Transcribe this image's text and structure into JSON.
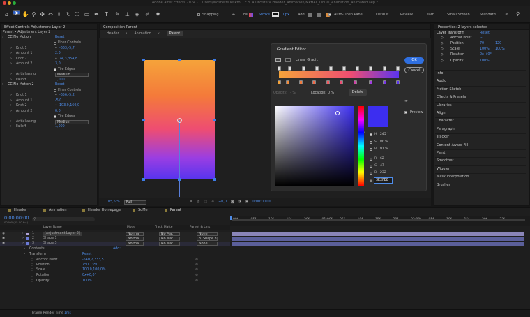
{
  "title": "Adobe After Effects 2024 - ...Users/inosbelt/Deskto... F > A Un5ste V Haeder_Animation/MPHAL_Doual_Animation_Animated.aep *",
  "toolbar": {
    "snapping": "Snapping",
    "fill": "Fill",
    "stroke": "Stroke",
    "stroke_px": "0 px",
    "add": "Add:",
    "auto_open": "Auto-Open Panel",
    "workspaces": [
      "Default",
      "Review",
      "Learn",
      "Small Screen",
      "Standard"
    ]
  },
  "effect_controls": {
    "tab": "Effect Controls Adjustment Layer 2",
    "layer": "Parent • Adjustment Layer 2",
    "rows": [
      {
        "label": "CC Flo Motion",
        "value": "Reset",
        "indent": 0
      },
      {
        "label": "Finer Controls",
        "value": "",
        "indent": 2,
        "check": false
      },
      {
        "label": "Knot 1",
        "value": "-663,-5,7",
        "indent": 1
      },
      {
        "label": "Amount 1",
        "value": "2,0",
        "indent": 1
      },
      {
        "label": "Knot 2",
        "value": "74,3,354,8",
        "indent": 1
      },
      {
        "label": "Amount 2",
        "value": "3,0",
        "indent": 1
      },
      {
        "label": "Tile Edges",
        "value": "",
        "indent": 2,
        "check": true
      },
      {
        "label": "Antialiasing",
        "value": "Medium",
        "indent": 1,
        "select": true
      },
      {
        "label": "Falloff",
        "value": "1,000",
        "indent": 1
      },
      {
        "label": "CC Flo Motion 2",
        "value": "Reset",
        "indent": 0
      },
      {
        "label": "Finer Controls",
        "value": "",
        "indent": 2,
        "check": false
      },
      {
        "label": "Knot 1",
        "value": "-656,-5,2",
        "indent": 1
      },
      {
        "label": "Amount 1",
        "value": "-5,0",
        "indent": 1
      },
      {
        "label": "Knot 2",
        "value": "103,0,160,0",
        "indent": 1
      },
      {
        "label": "Amount 2",
        "value": "0,0",
        "indent": 1
      },
      {
        "label": "Tile Edges",
        "value": "",
        "indent": 2,
        "check": true
      },
      {
        "label": "Antialiasing",
        "value": "Medium",
        "indent": 1,
        "select": true
      },
      {
        "label": "Falloff",
        "value": "1,000",
        "indent": 1
      }
    ]
  },
  "composition": {
    "tab": "Composition Parent",
    "crumbs": [
      "Header",
      "Animation",
      "Parent"
    ],
    "zoom": "105,6 %",
    "quality": "Full",
    "exposure": "+0,0",
    "timecode": "0:00:00:00"
  },
  "gradient_editor": {
    "title": "Gradient Editor",
    "type": "Linear Gradi...",
    "ok": "OK",
    "cancel": "Cancel",
    "opacity_label": "Opacity:",
    "opacity_value": "- %",
    "location_label": "Location:",
    "location_value": "0 %",
    "delete": "Delete",
    "preview": "Preview",
    "swatch_color": "#3c2ef0",
    "fields": [
      {
        "name": "H",
        "value": "245 °"
      },
      {
        "name": "S",
        "value": "80 %"
      },
      {
        "name": "B",
        "value": "91 %"
      },
      {
        "name": "R",
        "value": "62"
      },
      {
        "name": "G",
        "value": "47"
      },
      {
        "name": "B",
        "value": "232"
      }
    ],
    "hex": "3E2FE8"
  },
  "properties": {
    "header": "Properties: 2 layers selected",
    "group": "Layer Transform",
    "reset": "Reset",
    "rows": [
      {
        "label": "Anchor Point",
        "v1": "--",
        "v2": ""
      },
      {
        "label": "Position",
        "v1": "70",
        "v2": "120"
      },
      {
        "label": "Scale",
        "v1": "100%",
        "v2": "100%"
      },
      {
        "label": "Rotation",
        "v1": "0x +0°",
        "v2": ""
      },
      {
        "label": "Opacity",
        "v1": "100%",
        "v2": ""
      }
    ],
    "panels": [
      "Info",
      "Audio",
      "Motion Sketch",
      "Effects & Presets",
      "Libraries",
      "Align",
      "Character",
      "Paragraph",
      "Tracker",
      "Content-Aware Fill",
      "Paint",
      "Smoother",
      "Wiggler",
      "Mask Interpolation",
      "Brushes"
    ]
  },
  "timeline": {
    "tabs": [
      "Header",
      "Animation",
      "Header Homepage",
      "SoMe",
      "Parent"
    ],
    "timecode": "0:00:00:00",
    "fps": "00000 (25.00 fps)",
    "cols": {
      "name": "Layer Name",
      "mode": "Mode",
      "trkmat": "Track Matte",
      "parent": "Parent & Link"
    },
    "layers": [
      {
        "num": "1",
        "name": "[Adjustment Layer 2]",
        "mode": "Normal",
        "matte": "No Mat",
        "parent": "None",
        "color": "#b0a3d6"
      },
      {
        "num": "2",
        "name": "Shape 1",
        "mode": "Normal",
        "matte": "No Mat",
        "parent": "3. Shape 3",
        "color": "#6b7bd6"
      },
      {
        "num": "3",
        "name": "Shape 3",
        "mode": "Normal",
        "matte": "No Mat",
        "parent": "None",
        "color": "#6b7bd6"
      }
    ],
    "sub": [
      {
        "label": "Contents",
        "value": "Add:"
      },
      {
        "label": "Transform",
        "value": "Reset"
      },
      {
        "label": "Anchor Point",
        "value": "-540,7,333,5"
      },
      {
        "label": "Position",
        "value": "750,1350"
      },
      {
        "label": "Scale",
        "value": "100,0,100,0%"
      },
      {
        "label": "Rotation",
        "value": "0x+0,0°"
      },
      {
        "label": "Opacity",
        "value": "100%"
      }
    ],
    "ruler": [
      "00f",
      "05f",
      "10f",
      "15f",
      "20f",
      "01:00f",
      "05f",
      "10f",
      "15f",
      "20f",
      "02:00f",
      "05f",
      "10f",
      "15f",
      "20f",
      "2?f"
    ],
    "render_time": "Frame Render Time",
    "render_value": "1ms"
  }
}
